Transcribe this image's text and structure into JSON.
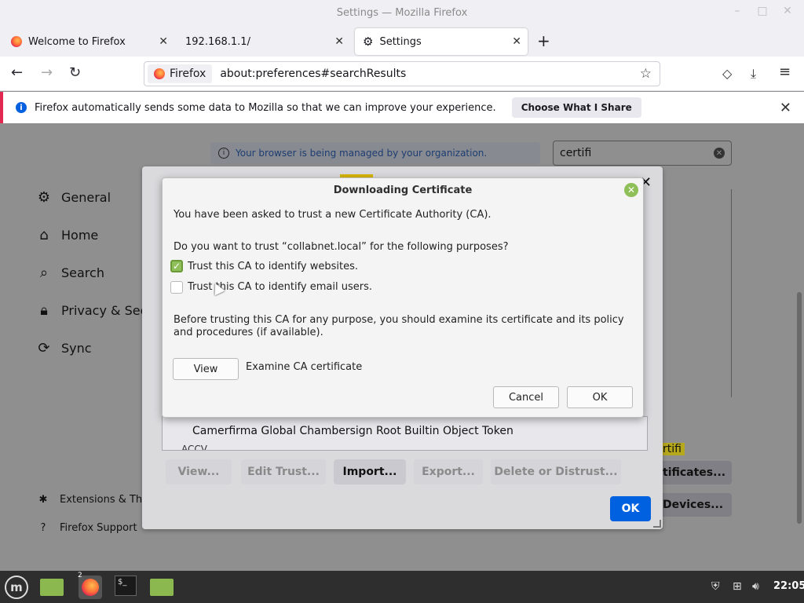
{
  "window": {
    "title": "Settings — Mozilla Firefox",
    "controls": {
      "minimize": "–",
      "maximize": "□",
      "close": "✕"
    }
  },
  "tabs": [
    {
      "label": "Welcome to Firefox",
      "icon": "firefox-icon",
      "active": false
    },
    {
      "label": "192.168.1.1/",
      "icon": "none",
      "active": false
    },
    {
      "label": "Settings",
      "icon": "gear-icon",
      "active": true
    }
  ],
  "tab_close": "✕",
  "new_tab": "+",
  "navbar": {
    "back": "←",
    "forward": "→",
    "reload": "↻",
    "identity_label": "Firefox",
    "url": "about:preferences#searchResults",
    "bookmark": "☆",
    "pocket": "◇",
    "download": "⤓",
    "menu": "≡"
  },
  "notification": {
    "icon": "i",
    "message": "Firefox automatically sends some data to Mozilla so that we can improve your experience.",
    "button": "Choose What I Share",
    "close": "✕"
  },
  "settings": {
    "managed_icon": "i",
    "managed_notice": "Your browser is being managed by your organization.",
    "search_value": "certifi",
    "search_clear": "✕",
    "sidebar": [
      {
        "icon": "⚙",
        "label": "General"
      },
      {
        "icon": "⌂",
        "label": "Home"
      },
      {
        "icon": "⌕",
        "label": "Search"
      },
      {
        "icon": "🔒︎",
        "label": "Privacy & Secu"
      },
      {
        "icon": "⟳",
        "label": "Sync"
      }
    ],
    "footer": [
      {
        "icon": "✱",
        "label": "Extensions & The"
      },
      {
        "icon": "?",
        "label": "Firefox Support"
      }
    ],
    "highlight_text": "rtifi",
    "right_buttons": [
      "tificates...",
      "Devices..."
    ]
  },
  "cert_manager": {
    "close": "✕",
    "list_row": {
      "name": "Camerfirma Global Chambersign Root",
      "token": "Builtin Object Token"
    },
    "list_row_partial": "ACCV",
    "buttons": [
      {
        "label": "View...",
        "enabled": false
      },
      {
        "label": "Edit Trust...",
        "enabled": false
      },
      {
        "label": "Import...",
        "enabled": true
      },
      {
        "label": "Export...",
        "enabled": false
      },
      {
        "label": "Delete or Distrust...",
        "enabled": false
      }
    ],
    "ok": "OK"
  },
  "download_dialog": {
    "title": "Downloading Certificate",
    "close": "✕",
    "intro": "You have been asked to trust a new Certificate Authority (CA).",
    "question": "Do you want to trust “collabnet.local” for the following purposes?",
    "options": [
      {
        "label": "Trust this CA to identify websites.",
        "checked": true,
        "mark": "✓"
      },
      {
        "label": "Trust this CA to identify email users.",
        "checked": false,
        "mark": ""
      }
    ],
    "advice": "Before trusting this CA for any purpose, you should examine its certificate and its policy and procedures (if available).",
    "view_button": "View",
    "view_caption": "Examine CA certificate",
    "cancel": "Cancel",
    "ok": "OK"
  },
  "taskbar": {
    "menu_logo": "m",
    "firefox_badge": "2",
    "terminal_glyph": "$_",
    "clock": "22:05",
    "tray_icons": [
      "shield-icon",
      "network-icon",
      "volume-icon"
    ],
    "tray_glyphs": [
      "⛨",
      "⊞",
      "🔊︎"
    ]
  },
  "colors": {
    "accent": "#0061e0",
    "check_green": "#8fbf58",
    "highlight": "#d7b500",
    "notification_border": "#e22850"
  }
}
